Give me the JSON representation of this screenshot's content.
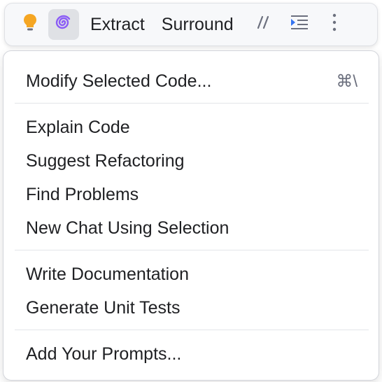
{
  "toolbar": {
    "icons": {
      "intention": "lightbulb-icon",
      "ai_assistant": "ai-assistant-spiral-icon",
      "comment": "comment-slashes-icon",
      "indent": "indent-lines-icon",
      "more": "more-vertical-icon"
    },
    "extract_label": "Extract",
    "surround_label": "Surround"
  },
  "menu": {
    "modify": {
      "label": "Modify Selected Code...",
      "shortcut": "⌘\\"
    },
    "explain": "Explain Code",
    "refactor": "Suggest Refactoring",
    "problems": "Find Problems",
    "new_chat": "New Chat Using Selection",
    "docs": "Write Documentation",
    "tests": "Generate Unit Tests",
    "add_prompts": "Add Your Prompts..."
  },
  "colors": {
    "bulb": "#f5a623",
    "ai_accent": "#8b5cf6",
    "icon_gray": "#6c707e",
    "indent_blue": "#3574f0"
  }
}
